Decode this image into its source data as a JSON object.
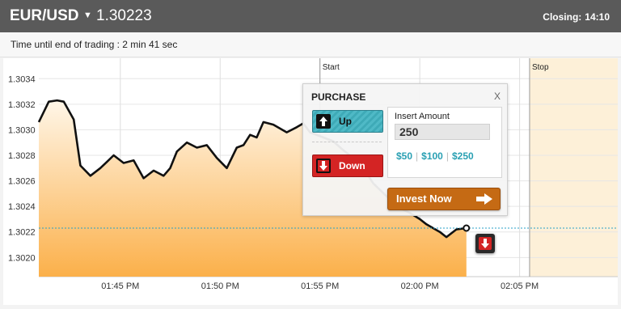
{
  "header": {
    "pair": "EUR/USD",
    "caret": "▼",
    "price": "1.30223",
    "closing_label": "Closing:",
    "closing_time": "14:10"
  },
  "subheader": {
    "time_left": "Time until end of trading : 2 min 41 sec"
  },
  "chart": {
    "markers": {
      "start": "Start",
      "stop": "Stop"
    },
    "y_ticks": [
      "1.3034",
      "1.3032",
      "1.3030",
      "1.3028",
      "1.3026",
      "1.3024",
      "1.3022",
      "1.3020"
    ],
    "x_ticks": [
      "01:45 PM",
      "01:50 PM",
      "01:55 PM",
      "02:00 PM",
      "02:05 PM"
    ],
    "current_level": 1.30223,
    "colors": {
      "line": "#111111",
      "fill_top": "#fff6e8",
      "fill_bottom": "#fbb04a",
      "stop_zone": "#fdf0d8",
      "current_level_line": "#2aa0c8"
    }
  },
  "chart_data": {
    "type": "area",
    "title": "",
    "xlabel": "",
    "ylabel": "",
    "ylim": [
      1.30185,
      1.30356
    ],
    "x_range": [
      "01:40:55 PM",
      "02:09:55 PM"
    ],
    "series": [
      {
        "x": [
          "01:40:55",
          "01:41:25",
          "01:41:50",
          "01:42:10",
          "01:42:40",
          "01:43:00",
          "01:43:30",
          "01:44:00",
          "01:44:20",
          "01:44:40",
          "01:45:10",
          "01:45:40",
          "01:46:10",
          "01:46:40",
          "01:47:10",
          "01:47:30",
          "01:47:50",
          "01:48:20",
          "01:48:50",
          "01:49:20",
          "01:49:50",
          "01:50:20",
          "01:50:50",
          "01:51:10",
          "01:51:30",
          "01:51:50",
          "01:52:10",
          "01:52:40",
          "01:53:20",
          "01:53:50",
          "01:54:10",
          "01:54:30",
          "01:55:10",
          "01:55:40",
          "01:56:10",
          "01:56:40",
          "01:57:10",
          "01:57:40",
          "01:58:20",
          "01:58:50",
          "01:59:30",
          "02:00:00",
          "02:00:20",
          "02:00:40",
          "02:01:00",
          "02:01:20",
          "02:01:50",
          "02:02:20"
        ],
        "y": [
          1.30306,
          1.30322,
          1.30323,
          1.30322,
          1.30308,
          1.30272,
          1.30264,
          1.3027,
          1.30275,
          1.3028,
          1.30274,
          1.30276,
          1.30262,
          1.30268,
          1.30264,
          1.3027,
          1.30283,
          1.3029,
          1.30286,
          1.30288,
          1.30278,
          1.3027,
          1.30286,
          1.30288,
          1.30296,
          1.30294,
          1.30306,
          1.30304,
          1.30298,
          1.30302,
          1.30305,
          1.30298,
          1.30294,
          1.30291,
          1.30284,
          1.30278,
          1.3027,
          1.30258,
          1.30248,
          1.3024,
          1.30235,
          1.3023,
          1.30226,
          1.30223,
          1.3022,
          1.30216,
          1.30222,
          1.30223
        ]
      }
    ],
    "grid": true,
    "annotations": [
      "Start",
      "Stop"
    ]
  },
  "purchase": {
    "title": "PURCHASE",
    "close": "X",
    "up_label": "Up",
    "down_label": "Down",
    "amount_label": "Insert Amount",
    "amount_value": "250",
    "presets": [
      "$50",
      "$100",
      "$250"
    ],
    "invest_label": "Invest Now"
  }
}
